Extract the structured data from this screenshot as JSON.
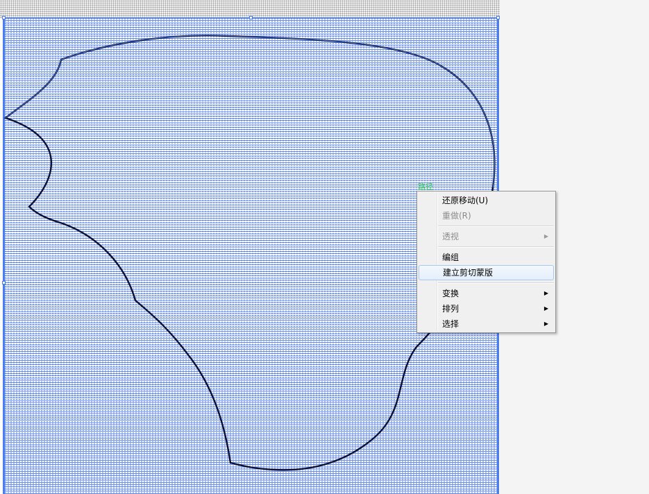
{
  "canvas": {
    "accent_color": "#4a7df0",
    "path_color": "#0d1030",
    "background": "#ffffff",
    "pasteboard_color": "#f4f4f4"
  },
  "cursor_hint": "路径",
  "context_menu": {
    "items": [
      {
        "label": "还原移动(U)",
        "enabled": true,
        "submenu": false
      },
      {
        "label": "重做(R)",
        "enabled": false,
        "submenu": false
      },
      {
        "separator": true
      },
      {
        "label": "透视",
        "enabled": false,
        "submenu": true
      },
      {
        "separator": true
      },
      {
        "label": "编组",
        "enabled": true,
        "submenu": false
      },
      {
        "label": "建立剪切蒙版",
        "enabled": true,
        "submenu": false,
        "highlighted": true
      },
      {
        "separator": true
      },
      {
        "label": "变换",
        "enabled": true,
        "submenu": true
      },
      {
        "label": "排列",
        "enabled": true,
        "submenu": true
      },
      {
        "label": "选择",
        "enabled": true,
        "submenu": true
      }
    ],
    "submenu_arrow_icon": "chevron-right-icon"
  }
}
